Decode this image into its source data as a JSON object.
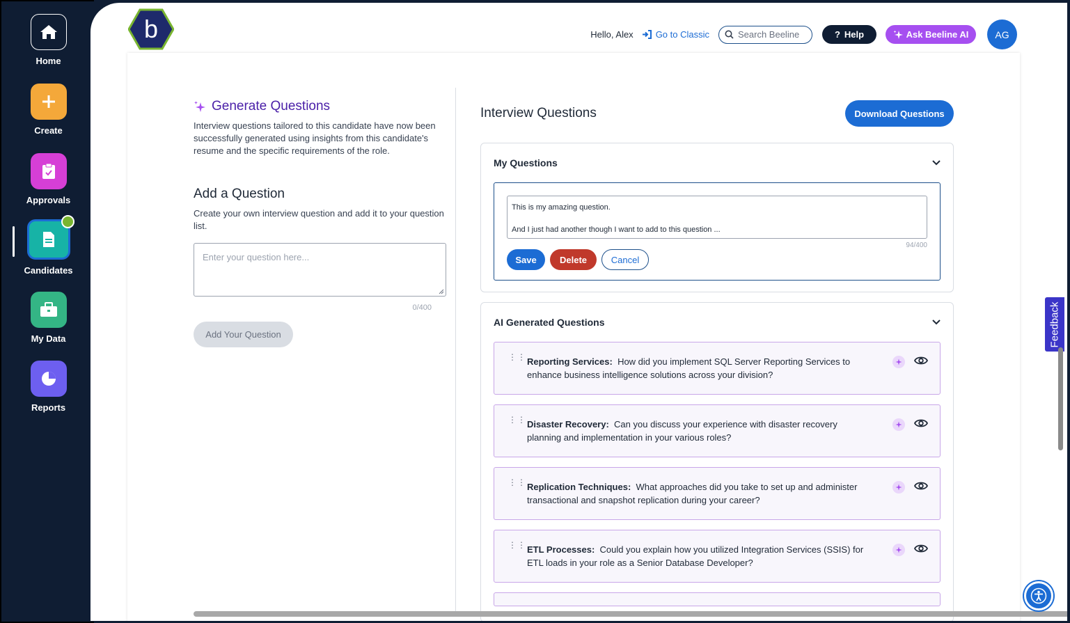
{
  "sidebar": {
    "items": [
      {
        "label": "Home",
        "icon": "home-icon"
      },
      {
        "label": "Create",
        "icon": "plus-icon"
      },
      {
        "label": "Approvals",
        "icon": "clipboard-check-icon"
      },
      {
        "label": "Candidates",
        "icon": "document-icon"
      },
      {
        "label": "My Data",
        "icon": "briefcase-icon"
      },
      {
        "label": "Reports",
        "icon": "pie-chart-icon"
      }
    ],
    "active": "Candidates"
  },
  "header": {
    "logo_letter": "b",
    "greeting": "Hello, Alex",
    "classic_link": "Go to Classic",
    "search_placeholder": "Search Beeline",
    "help_label": "Help",
    "ai_label": "Ask Beeline AI",
    "avatar_initials": "AG"
  },
  "generate": {
    "title": "Generate Questions",
    "description": "Interview questions tailored to this candidate have now been successfully generated using insights from this candidate's resume and the specific requirements of the role."
  },
  "add_question": {
    "title": "Add a Question",
    "description": "Create your own interview question and add it to your question list.",
    "placeholder": "Enter your question here...",
    "counter": "0/400",
    "button": "Add Your Question"
  },
  "interview": {
    "title": "Interview Questions",
    "download_label": "Download Questions",
    "my_questions": {
      "title": "My Questions",
      "line1": "This is my amazing question.",
      "line2": "And I just had another though I want to add to this question ...",
      "counter": "94/400",
      "save": "Save",
      "delete": "Delete",
      "cancel": "Cancel"
    },
    "ai_questions": {
      "title": "AI Generated Questions",
      "items": [
        {
          "topic": "Reporting Services:",
          "text": "How did you implement SQL Server Reporting Services to enhance business intelligence solutions across your division?"
        },
        {
          "topic": "Disaster Recovery:",
          "text": "Can you discuss your experience with disaster recovery planning and implementation in your various roles?"
        },
        {
          "topic": "Replication Techniques:",
          "text": "What approaches did you take to set up and administer transactional and snapshot replication during your career?"
        },
        {
          "topic": "ETL Processes:",
          "text": "Could you explain how you utilized Integration Services (SSIS) for ETL loads in your role as a Senior Database Developer?"
        }
      ]
    }
  },
  "feedback_label": "Feedback",
  "colors": {
    "sidebar": "#0f1d33",
    "primary": "#1c6cd4",
    "ai_purple": "#a64ff0",
    "delete_red": "#c0392b"
  }
}
